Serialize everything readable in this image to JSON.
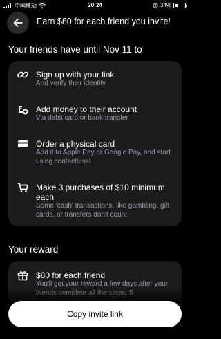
{
  "status_bar": {
    "carrier": "中国移动",
    "time": "20:24",
    "battery": "34%",
    "battery_level": 0.34
  },
  "header": {
    "title": "Earn $80 for each friend you invite!",
    "back_icon": "arrow-left-icon"
  },
  "steps_section": {
    "title": "Your friends have until Nov 11 to",
    "steps": [
      {
        "icon": "link-icon",
        "title": "Sign up with your link",
        "desc": "And verify their identity"
      },
      {
        "icon": "money-add-icon",
        "title": "Add money to their account",
        "desc": "Via debit card or bank transfer"
      },
      {
        "icon": "card-icon",
        "title": "Order a physical card",
        "desc": "Add it to Apple Pay or Google Pay, and start using contactless!"
      },
      {
        "icon": "cart-icon",
        "title": "Make 3 purchases of $10 minimum each",
        "desc": "Some 'cash' transactions, like gambling, gift cards, or transfers don't count"
      }
    ]
  },
  "reward_section": {
    "title": "Your reward",
    "item": {
      "icon": "gift-icon",
      "title": "$80 for each friend",
      "desc": "You'll get your reward a few days after your friends complete all the steps. 5"
    }
  },
  "cta": {
    "label": "Copy invite link"
  },
  "colors": {
    "background": "#000000",
    "card": "#1c1c1e",
    "muted_text": "#9b9ba1",
    "button": "#ffffff"
  }
}
